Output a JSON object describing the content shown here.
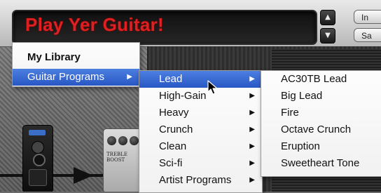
{
  "header": {
    "display_title": "Play Yer Guitar!",
    "side_button_top": "In",
    "side_button_bottom": "Sa"
  },
  "scene": {
    "pedal_label": "TREBLE BOOST"
  },
  "library_menu": {
    "header": "My Library",
    "items": [
      {
        "label": "Guitar Programs",
        "selected": true,
        "has_submenu": true
      }
    ]
  },
  "programs_menu": {
    "items": [
      {
        "label": "Lead",
        "selected": true
      },
      {
        "label": "High-Gain",
        "selected": false
      },
      {
        "label": "Heavy",
        "selected": false
      },
      {
        "label": "Crunch",
        "selected": false
      },
      {
        "label": "Clean",
        "selected": false
      },
      {
        "label": "Sci-fi",
        "selected": false
      },
      {
        "label": "Artist Programs",
        "selected": false
      }
    ]
  },
  "lead_menu": {
    "items": [
      {
        "label": "AC30TB Lead"
      },
      {
        "label": "Big Lead"
      },
      {
        "label": "Fire"
      },
      {
        "label": "Octave Crunch"
      },
      {
        "label": "Eruption"
      },
      {
        "label": "Sweetheart Tone"
      }
    ]
  },
  "icons": {
    "submenu_arrow": "▶",
    "nav_up": "▲",
    "nav_down": "▼",
    "cursor": "arrow-cursor-icon"
  },
  "colors": {
    "title_text": "#e02020",
    "selection": "#2f62d0"
  }
}
